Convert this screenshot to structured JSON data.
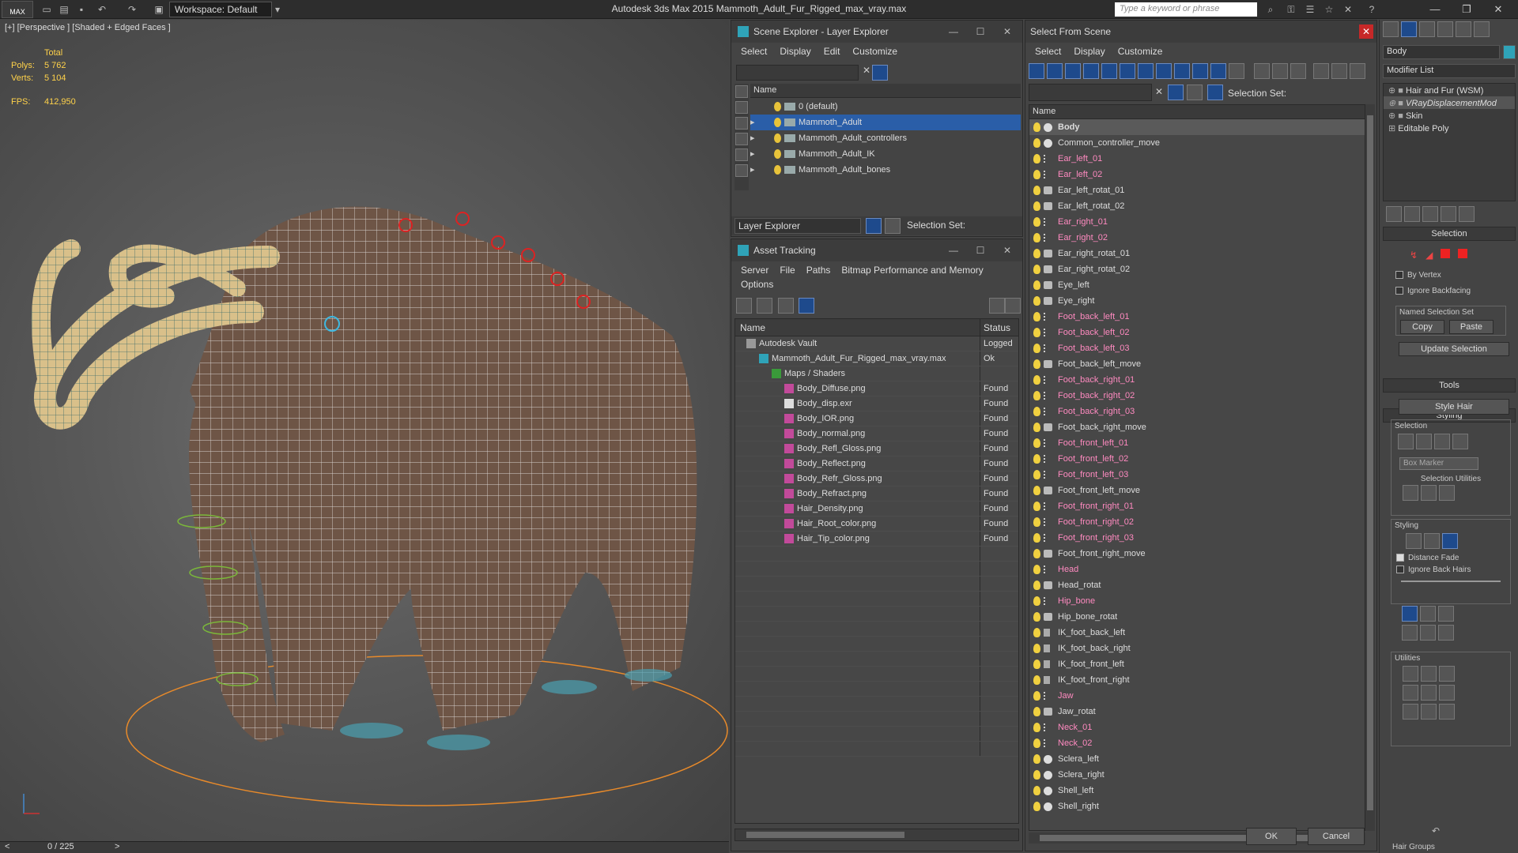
{
  "titlebar": {
    "logo": "MAX",
    "workspace": "Workspace: Default",
    "title": "Autodesk 3ds Max  2015    Mammoth_Adult_Fur_Rigged_max_vray.max",
    "search_placeholder": "Type a keyword or phrase"
  },
  "viewport": {
    "label": "[+] [Perspective ] [Shaded + Edged Faces ]",
    "stats": {
      "total": "Total",
      "polys_label": "Polys:",
      "polys": "5 762",
      "verts_label": "Verts:",
      "verts": "5 104",
      "fps_label": "FPS:",
      "fps": "412,950"
    },
    "timeline": "0 / 225"
  },
  "scene_explorer": {
    "title": "Scene Explorer - Layer Explorer",
    "menu": [
      "Select",
      "Display",
      "Edit",
      "Customize"
    ],
    "column": "Name",
    "layers": [
      "0 (default)",
      "Mammoth_Adult",
      "Mammoth_Adult_controllers",
      "Mammoth_Adult_IK",
      "Mammoth_Adult_bones"
    ],
    "selected_index": 1,
    "footer_dropdown": "Layer Explorer",
    "selection_set": "Selection Set:"
  },
  "asset_tracking": {
    "title": "Asset Tracking",
    "menu": [
      "Server",
      "File",
      "Paths",
      "Bitmap Performance and Memory"
    ],
    "menu2": "Options",
    "col_name": "Name",
    "col_status": "Status",
    "rows": [
      {
        "name": "Autodesk Vault",
        "status": "Logged",
        "indent": 0,
        "kind": "vault"
      },
      {
        "name": "Mammoth_Adult_Fur_Rigged_max_vray.max",
        "status": "Ok",
        "indent": 1,
        "kind": "max"
      },
      {
        "name": "Maps / Shaders",
        "status": "",
        "indent": 2,
        "kind": "folder"
      },
      {
        "name": "Body_Diffuse.png",
        "status": "Found",
        "indent": 3,
        "kind": "png"
      },
      {
        "name": "Body_disp.exr",
        "status": "Found",
        "indent": 3,
        "kind": "exr"
      },
      {
        "name": "Body_IOR.png",
        "status": "Found",
        "indent": 3,
        "kind": "png"
      },
      {
        "name": "Body_normal.png",
        "status": "Found",
        "indent": 3,
        "kind": "png"
      },
      {
        "name": "Body_Refl_Gloss.png",
        "status": "Found",
        "indent": 3,
        "kind": "png"
      },
      {
        "name": "Body_Reflect.png",
        "status": "Found",
        "indent": 3,
        "kind": "png"
      },
      {
        "name": "Body_Refr_Gloss.png",
        "status": "Found",
        "indent": 3,
        "kind": "png"
      },
      {
        "name": "Body_Refract.png",
        "status": "Found",
        "indent": 3,
        "kind": "png"
      },
      {
        "name": "Hair_Density.png",
        "status": "Found",
        "indent": 3,
        "kind": "png"
      },
      {
        "name": "Hair_Root_color.png",
        "status": "Found",
        "indent": 3,
        "kind": "png"
      },
      {
        "name": "Hair_Tip_color.png",
        "status": "Found",
        "indent": 3,
        "kind": "png"
      }
    ]
  },
  "select_from_scene": {
    "title": "Select From Scene",
    "menu": [
      "Select",
      "Display",
      "Customize"
    ],
    "selection_set": "Selection Set:",
    "column": "Name",
    "ok": "OK",
    "cancel": "Cancel",
    "items": [
      {
        "name": "Body",
        "kind": "mesh",
        "selected": true
      },
      {
        "name": "Common_controller_move",
        "kind": "mesh"
      },
      {
        "name": "Ear_left_01",
        "kind": "bone"
      },
      {
        "name": "Ear_left_02",
        "kind": "bone"
      },
      {
        "name": "Ear_left_rotat_01",
        "kind": "ctrl"
      },
      {
        "name": "Ear_left_rotat_02",
        "kind": "ctrl"
      },
      {
        "name": "Ear_right_01",
        "kind": "bone"
      },
      {
        "name": "Ear_right_02",
        "kind": "bone"
      },
      {
        "name": "Ear_right_rotat_01",
        "kind": "ctrl"
      },
      {
        "name": "Ear_right_rotat_02",
        "kind": "ctrl"
      },
      {
        "name": "Eye_left",
        "kind": "ctrl"
      },
      {
        "name": "Eye_right",
        "kind": "ctrl"
      },
      {
        "name": "Foot_back_left_01",
        "kind": "bone"
      },
      {
        "name": "Foot_back_left_02",
        "kind": "bone"
      },
      {
        "name": "Foot_back_left_03",
        "kind": "bone"
      },
      {
        "name": "Foot_back_left_move",
        "kind": "ctrl"
      },
      {
        "name": "Foot_back_right_01",
        "kind": "bone"
      },
      {
        "name": "Foot_back_right_02",
        "kind": "bone"
      },
      {
        "name": "Foot_back_right_03",
        "kind": "bone"
      },
      {
        "name": "Foot_back_right_move",
        "kind": "ctrl"
      },
      {
        "name": "Foot_front_left_01",
        "kind": "bone"
      },
      {
        "name": "Foot_front_left_02",
        "kind": "bone"
      },
      {
        "name": "Foot_front_left_03",
        "kind": "bone"
      },
      {
        "name": "Foot_front_left_move",
        "kind": "ctrl"
      },
      {
        "name": "Foot_front_right_01",
        "kind": "bone"
      },
      {
        "name": "Foot_front_right_02",
        "kind": "bone"
      },
      {
        "name": "Foot_front_right_03",
        "kind": "bone"
      },
      {
        "name": "Foot_front_right_move",
        "kind": "ctrl"
      },
      {
        "name": "Head",
        "kind": "bone"
      },
      {
        "name": "Head_rotat",
        "kind": "ctrl"
      },
      {
        "name": "Hip_bone",
        "kind": "bone"
      },
      {
        "name": "Hip_bone_rotat",
        "kind": "ctrl"
      },
      {
        "name": "IK_foot_back_left",
        "kind": "ik"
      },
      {
        "name": "IK_foot_back_right",
        "kind": "ik"
      },
      {
        "name": "IK_foot_front_left",
        "kind": "ik"
      },
      {
        "name": "IK_foot_front_right",
        "kind": "ik"
      },
      {
        "name": "Jaw",
        "kind": "bone"
      },
      {
        "name": "Jaw_rotat",
        "kind": "ctrl"
      },
      {
        "name": "Neck_01",
        "kind": "bone"
      },
      {
        "name": "Neck_02",
        "kind": "bone"
      },
      {
        "name": "Sclera_left",
        "kind": "mesh"
      },
      {
        "name": "Sclera_right",
        "kind": "mesh"
      },
      {
        "name": "Shell_left",
        "kind": "mesh"
      },
      {
        "name": "Shell_right",
        "kind": "mesh"
      }
    ]
  },
  "command_panel": {
    "object_name": "Body",
    "modifier_list": "Modifier List",
    "stack": [
      "Hair and Fur (WSM)",
      "VRayDisplacementMod",
      "Skin",
      "Editable Poly"
    ],
    "selection_header": "Selection",
    "by_vertex": "By Vertex",
    "ignore_backfacing": "Ignore Backfacing",
    "named_selection_set": "Named Selection Set",
    "copy": "Copy",
    "paste": "Paste",
    "update_selection": "Update Selection",
    "tools_header": "Tools",
    "styling_header": "Styling",
    "style_hair": "Style Hair",
    "selection_group": "Selection",
    "box_marker": "Box Marker",
    "selection_utilities": "Selection Utilities",
    "styling_group": "Styling",
    "distance_fade": "Distance Fade",
    "ignore_back_hairs": "Ignore Back Hairs",
    "utilities_group": "Utilities",
    "hair_groups": "Hair Groups"
  },
  "colors": {
    "selected": "#2a5ea8",
    "bone_text": "#ff8ac0",
    "mesh_text": "#dddddd",
    "accent_blue": "#1e4a8c"
  }
}
